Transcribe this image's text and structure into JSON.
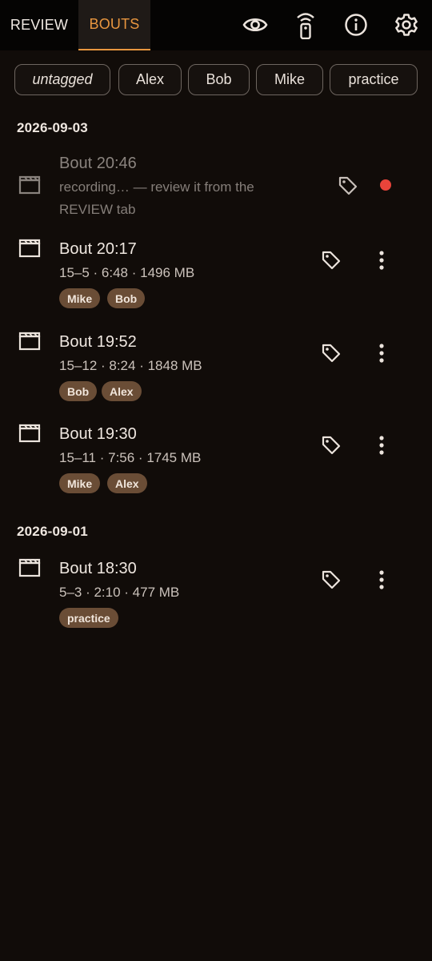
{
  "header": {
    "tabs": [
      {
        "label": "REVIEW",
        "active": false
      },
      {
        "label": "BOUTS",
        "active": true
      }
    ],
    "icons": [
      "eye-icon",
      "remote-icon",
      "info-icon",
      "gear-icon"
    ],
    "accent": "#e8963f"
  },
  "filters": [
    {
      "label": "untagged",
      "italic": true
    },
    {
      "label": "Alex"
    },
    {
      "label": "Bob"
    },
    {
      "label": "Mike"
    },
    {
      "label": "practice"
    }
  ],
  "groups": [
    {
      "date": "2026-09-03",
      "bouts": [
        {
          "title": "Bout 20:46",
          "meta": "recording… — review it from the REVIEW tab",
          "recording": true,
          "tags": []
        },
        {
          "title": "Bout 20:17",
          "meta": "15–5 · 6:48 · 1496 MB",
          "tags": [
            "Mike",
            "Bob"
          ]
        },
        {
          "title": "Bout 19:52",
          "meta": "15–12 · 8:24 · 1848 MB",
          "tags": [
            "Bob",
            "Alex"
          ]
        },
        {
          "title": "Bout 19:30",
          "meta": "15–11 · 7:56 · 1745 MB",
          "tags": [
            "Mike",
            "Alex"
          ]
        }
      ]
    },
    {
      "date": "2026-09-01",
      "bouts": [
        {
          "title": "Bout 18:30",
          "meta": "5–3 · 2:10 · 477 MB",
          "tags": [
            "practice"
          ]
        }
      ]
    }
  ],
  "colors": {
    "recording_dot": "#e8443a",
    "tag_pill": "#6a4d36"
  }
}
